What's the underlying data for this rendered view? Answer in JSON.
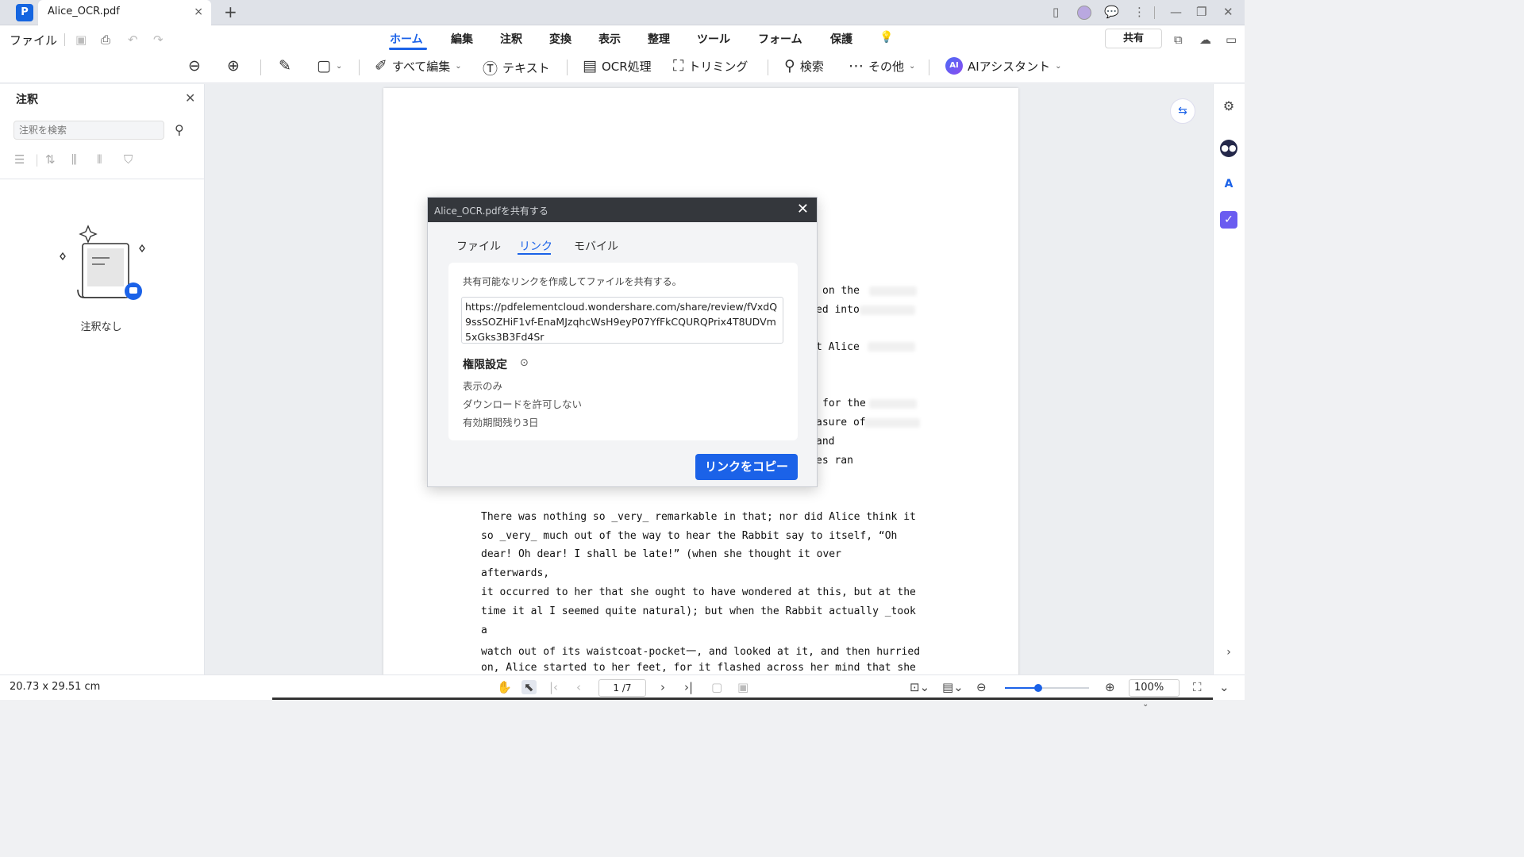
{
  "titlebar": {
    "tab_title": "Alice_OCR.pdf",
    "tab_close": "×",
    "add_tab": "+",
    "minimize": "—",
    "restore": "❐",
    "close": "✕"
  },
  "menubar": {
    "file": "ファイル",
    "tabs": [
      "ホーム",
      "編集",
      "注釈",
      "変換",
      "表示",
      "整理",
      "ツール",
      "フォーム",
      "保護"
    ],
    "active_tab": "ホーム",
    "share": "共有"
  },
  "toolbar": {
    "edit_all": "すべて編集",
    "text": "テキスト",
    "ocr": "OCR処理",
    "crop": "トリミング",
    "search": "検索",
    "more": "その他",
    "ai_assistant": "AIアシスタント",
    "ai_badge": "AI"
  },
  "left_panel": {
    "title": "注釈",
    "search_placeholder": "注釈を検索",
    "empty_text": "注釈なし"
  },
  "document": {
    "right_fragments": [
      "on the",
      "ed into",
      "t Alice",
      "for the",
      "asure of",
      "and",
      "es ran"
    ],
    "lines": [
      "There was nothing so _very_ remarkable in that; nor did Alice think it",
      "so _very_ much out of the way to hear the Rabbit say to itself, “Oh",
      "dear! Oh dear! I shall be late!” (when she thought it over",
      "afterwards,",
      " it occurred to her that she ought to have wondered at this, but at the",
      "time it al I seemed quite natural); but when the Rabbit actually _took",
      "a",
      "watch out of its waistcoat-pocket一, and looked at it, and then hurried",
      "on, Alice started to her feet, for it flashed across her mind that she"
    ]
  },
  "dialog": {
    "title": "Alice_OCR.pdfを共有する",
    "tabs": [
      "ファイル",
      "リンク",
      "モバイル"
    ],
    "active_tab": "リンク",
    "description": "共有可能なリンクを作成してファイルを共有する。",
    "link": "https://pdfelementcloud.wondershare.com/share/review/fVxdQ9ssSOZHiF1vf-EnaMJzqhcWsH9eyP07YfFkCQURQPrix4T8UDVm5xGks3B3Fd4Sr",
    "permissions_title": "権限設定",
    "permissions": [
      "表示のみ",
      "ダウンロードを許可しない",
      "有効期間残り3日"
    ],
    "copy_button": "リンクをコピー"
  },
  "statusbar": {
    "dimensions": "20.73 x 29.51 cm",
    "page_indicator": "1 /7",
    "zoom": "100%",
    "zoom_fraction": 0.4
  },
  "colors": {
    "accent": "#1b62e8",
    "dialog_header": "#34373c"
  }
}
